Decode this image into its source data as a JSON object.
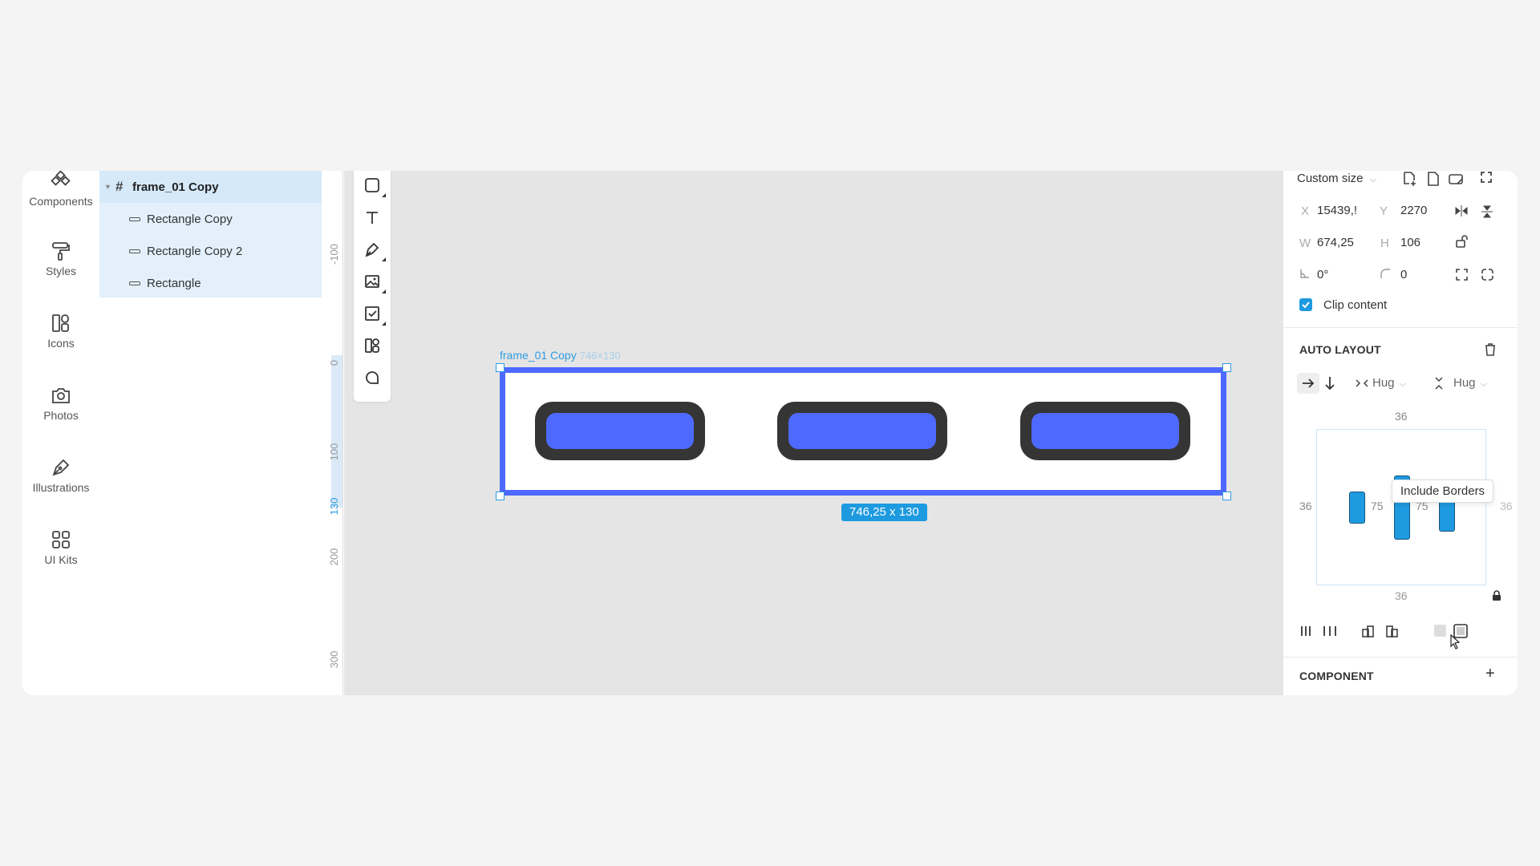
{
  "iconbar": {
    "items": [
      {
        "label": "Components",
        "icon": "components-icon"
      },
      {
        "label": "Styles",
        "icon": "paint-roller-icon"
      },
      {
        "label": "Icons",
        "icon": "icons-icon"
      },
      {
        "label": "Photos",
        "icon": "camera-icon"
      },
      {
        "label": "Illustrations",
        "icon": "pen-nib-icon"
      },
      {
        "label": "UI Kits",
        "icon": "grid-icon"
      }
    ]
  },
  "layers": {
    "root": "frame_01 Copy",
    "children": [
      "Rectangle Copy",
      "Rectangle Copy 2",
      "Rectangle"
    ]
  },
  "ruler": {
    "ticks": [
      "-100",
      "0",
      "100",
      "130",
      "200",
      "300"
    ]
  },
  "canvas": {
    "frame_name": "frame_01 Copy",
    "frame_size_hint": "746×130",
    "size_badge": "746,25 x 130",
    "colors": {
      "frame_border": "#4d69ff",
      "pill_outer": "#353535",
      "pill_inner": "#4d69ff",
      "selection": "#1e9ae0"
    }
  },
  "panel": {
    "size_preset": "Custom size",
    "x_label": "X",
    "x_value": "15439,!",
    "y_label": "Y",
    "y_value": "2270",
    "w_label": "W",
    "w_value": "674,25",
    "h_label": "H",
    "h_value": "106",
    "rotation_value": "0°",
    "radius_value": "0",
    "clip_content_label": "Clip content",
    "clip_content_checked": true,
    "auto_layout_title": "AUTO LAYOUT",
    "width_mode": "Hug",
    "height_mode": "Hug",
    "padding_top": "36",
    "padding_left": "36",
    "padding_right": "36",
    "padding_bottom": "36",
    "gap_1": "75",
    "gap_2": "75",
    "component_title": "COMPONENT",
    "tooltip": "Include Borders"
  }
}
